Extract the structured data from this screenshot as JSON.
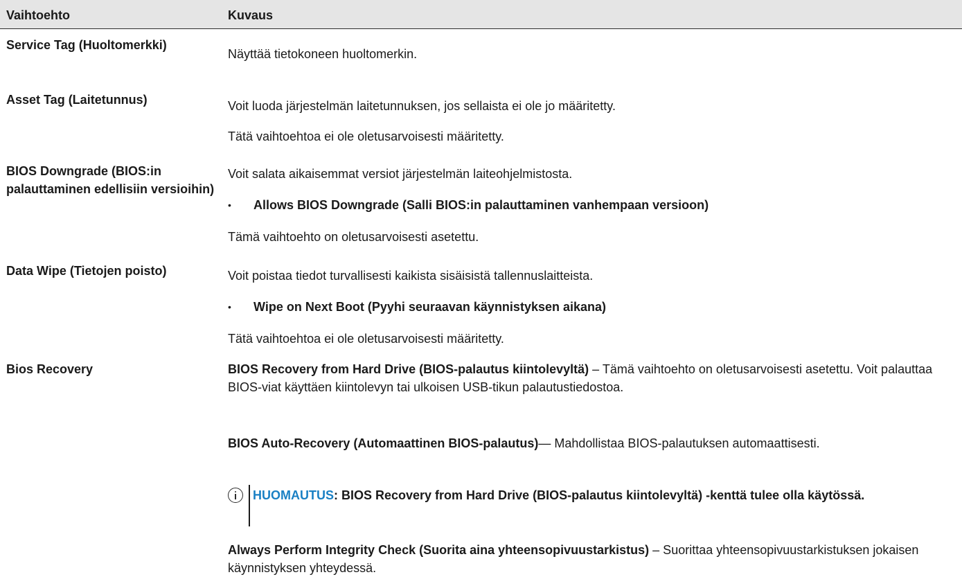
{
  "header": {
    "col1": "Vaihtoehto",
    "col2": "Kuvaus"
  },
  "rows": [
    {
      "option": "Service Tag (Huoltomerkki)",
      "p1": "Näyttää tietokoneen huoltomerkin."
    },
    {
      "option": "Asset Tag (Laitetunnus)",
      "p1": "Voit luoda järjestelmän laitetunnuksen, jos sellaista ei ole jo määritetty.",
      "p2": "Tätä vaihtoehtoa ei ole oletusarvoisesti määritetty."
    },
    {
      "option": "BIOS Downgrade (BIOS:in palauttaminen edellisiin versioihin)",
      "p1": "Voit salata aikaisemmat versiot järjestelmän laiteohjelmistosta.",
      "bullet": "Allows BIOS Downgrade (Salli BIOS:in palauttaminen vanhempaan versioon)",
      "p2": "Tämä vaihtoehto on oletusarvoisesti asetettu."
    },
    {
      "option": "Data Wipe (Tietojen poisto)",
      "p1": "Voit poistaa tiedot turvallisesti kaikista sisäisistä tallennuslaitteista.",
      "bullet": "Wipe on Next Boot (Pyyhi seuraavan käynnistyksen aikana)",
      "p2": "Tätä vaihtoehtoa ei ole oletusarvoisesti määritetty."
    },
    {
      "option": "Bios Recovery",
      "p1_bold": "BIOS Recovery from Hard Drive (BIOS-palautus kiintolevyltä)",
      "p1_rest": " – Tämä vaihtoehto on oletusarvoisesti asetettu. Voit palauttaa BIOS-viat käyttäen kiintolevyn tai ulkoisen USB-tikun palautustiedostoa.",
      "p2_bold": "BIOS Auto-Recovery (Automaattinen BIOS-palautus)",
      "p2_rest": "— Mahdollistaa BIOS-palautuksen automaattisesti.",
      "note_label": "HUOMAUTUS",
      "note_text": ": BIOS Recovery from Hard Drive (BIOS-palautus kiintolevyltä) -kenttä tulee olla käytössä.",
      "p3_bold": "Always Perform Integrity Check (Suorita aina yhteensopivuustarkistus)",
      "p3_rest": " – Suorittaa yhteensopivuustarkistuksen jokaisen käynnistyksen yhteydessä."
    }
  ],
  "colors": {
    "header_bg": "#e5e5e5",
    "note_label": "#1a80c4"
  },
  "icons": {
    "note": "info-circle-icon"
  }
}
